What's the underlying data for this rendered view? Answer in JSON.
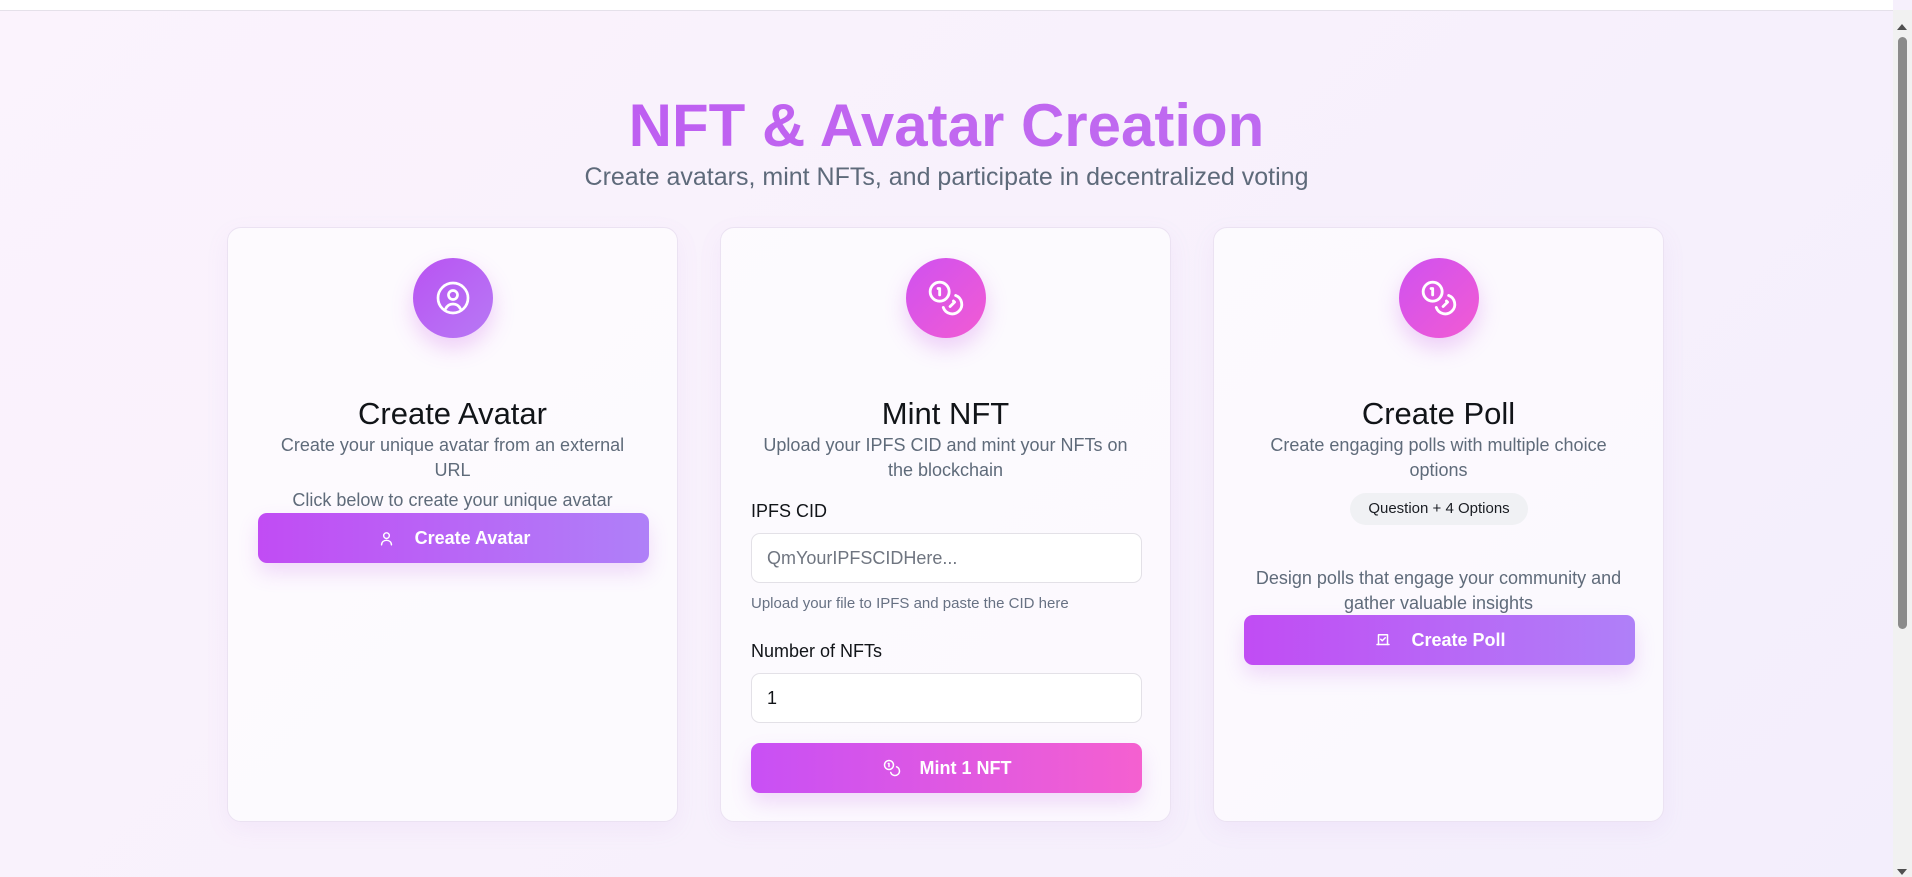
{
  "header": {
    "title": "NFT & Avatar Creation",
    "subtitle": "Create avatars, mint NFTs, and participate in decentralized voting"
  },
  "avatar_card": {
    "icon": "user-circle-icon",
    "title": "Create Avatar",
    "description": "Create your unique avatar from an external URL",
    "note": "Click below to create your unique avatar",
    "button_label": "Create Avatar",
    "button_icon": "user-icon"
  },
  "nft_card": {
    "icon": "coins-icon",
    "title": "Mint NFT",
    "description": "Upload your IPFS CID and mint your NFTs on the blockchain",
    "cid_label": "IPFS CID",
    "cid_placeholder": "QmYourIPFSCIDHere...",
    "cid_value": "",
    "cid_help": "Upload your file to IPFS and paste the CID here",
    "count_label": "Number of NFTs",
    "count_value": "1",
    "button_label": "Mint 1 NFT",
    "button_icon": "coins-icon"
  },
  "poll_card": {
    "icon": "coins-icon",
    "title": "Create Poll",
    "description": "Create engaging polls with multiple choice options",
    "badge": "Question + 4 Options",
    "note": "Design polls that engage your community and gather valuable insights",
    "button_label": "Create Poll",
    "button_icon": "vote-box-icon"
  },
  "colors": {
    "title_gradient_start": "#b84cf3",
    "title_gradient_end": "#b76cf2",
    "button_purple_start": "#c14cf4",
    "button_purple_end": "#af80f8",
    "button_pink_start": "#c850f5",
    "button_pink_end": "#f560d0",
    "card_background": "#ffffff",
    "body_text": "#5f6b7a"
  }
}
